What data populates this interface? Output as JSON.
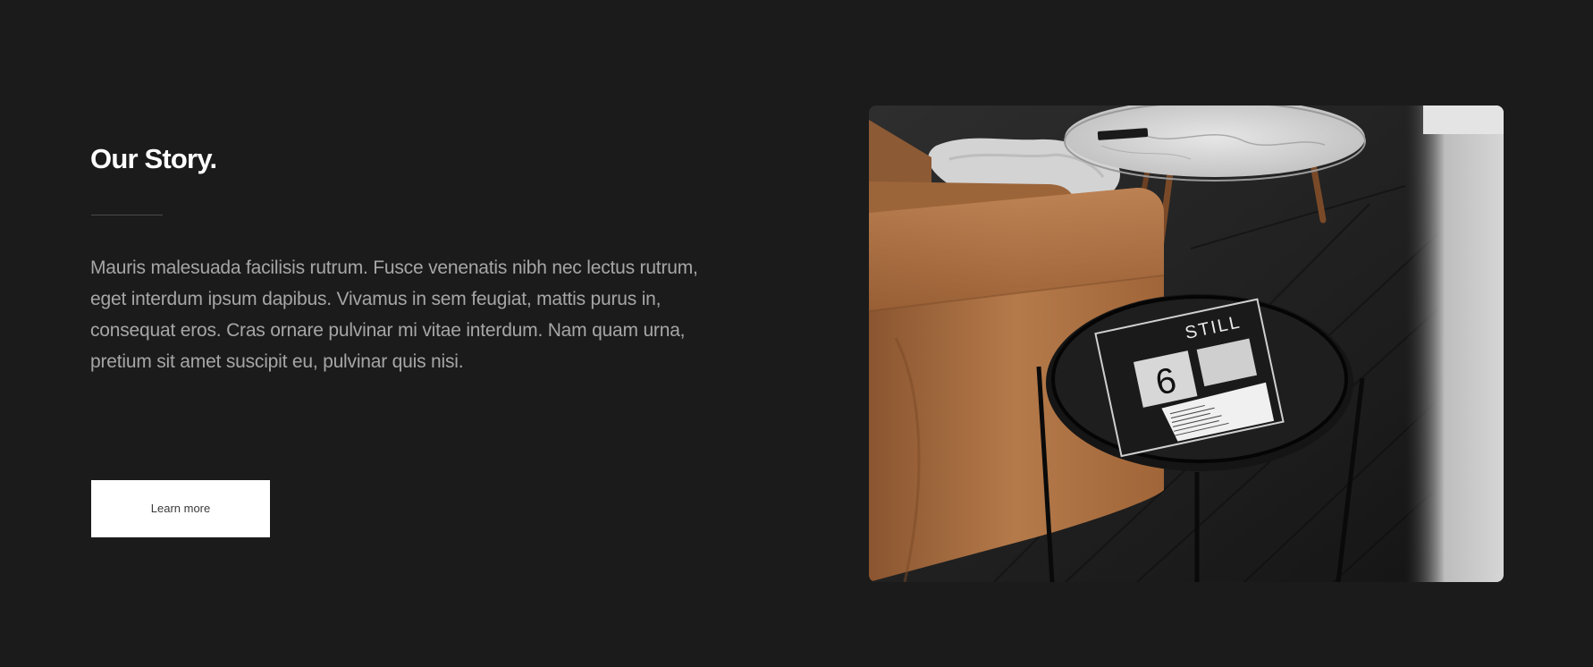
{
  "story": {
    "title": "Our Story.",
    "body": "Mauris malesuada facilisis rutrum. Fusce venenatis nibh nec lectus rutrum, eget interdum ipsum dapibus. Vivamus in sem feugiat, mattis purus in, consequat eros. Cras ornare pulvinar mi vitae interdum. Nam quam urna, pretium sit amet suscipit eu, pulvinar quis nisi.",
    "button_label": "Learn more"
  },
  "photo": {
    "magazine_title": "STILL",
    "magazine_number": "6"
  },
  "colors": {
    "background": "#1b1b1b",
    "title": "#ffffff",
    "body_text": "#a6a6a6",
    "button_bg": "#ffffff",
    "button_text": "#3a3a3a",
    "leather": "#a86b3e"
  }
}
